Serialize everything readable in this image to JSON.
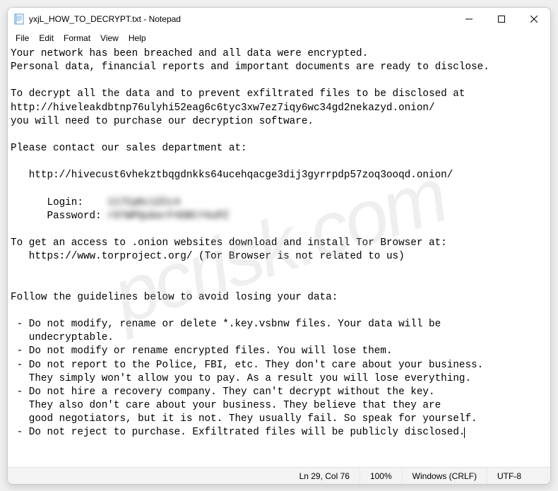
{
  "titlebar": {
    "title": "yxjL_HOW_TO_DECRYPT.txt - Notepad"
  },
  "menubar": {
    "file": "File",
    "edit": "Edit",
    "format": "Format",
    "view": "View",
    "help": "Help"
  },
  "content": {
    "line1": "Your network has been breached and all data were encrypted.",
    "line2": "Personal data, financial reports and important documents are ready to disclose.",
    "line3": "",
    "line4": "To decrypt all the data and to prevent exfiltrated files to be disclosed at",
    "line5": "http://hiveleakdbtnp76ulyhi52eag6c6tyc3xw7ez7iqy6wc34gd2nekazyd.onion/",
    "line6": "you will need to purchase our decryption software.",
    "line7": "",
    "line8": "Please contact our sales department at:",
    "line9": "",
    "line10": "   http://hivecust6vhekztbqgdnkks64ucehqacge3dij3gyrrpdp57zoq3ooqd.onion/",
    "line11": "",
    "login_label": "      Login:    ",
    "login_value": "117CpKc1ZCc4",
    "password_label": "      Password: ",
    "password_value": "r97WPQuberF4GBtY4uPZ",
    "line14": "",
    "line15": "To get an access to .onion websites download and install Tor Browser at:",
    "line16": "   https://www.torproject.org/ (Tor Browser is not related to us)",
    "line17": "",
    "line18": "",
    "line19": "Follow the guidelines below to avoid losing your data:",
    "line20": "",
    "line21": " - Do not modify, rename or delete *.key.vsbnw files. Your data will be",
    "line22": "   undecryptable.",
    "line23": " - Do not modify or rename encrypted files. You will lose them.",
    "line24": " - Do not report to the Police, FBI, etc. They don't care about your business.",
    "line25": "   They simply won't allow you to pay. As a result you will lose everything.",
    "line26": " - Do not hire a recovery company. They can't decrypt without the key.",
    "line27": "   They also don't care about your business. They believe that they are",
    "line28": "   good negotiators, but it is not. They usually fail. So speak for yourself.",
    "line29": " - Do not reject to purchase. Exfiltrated files will be publicly disclosed."
  },
  "statusbar": {
    "position": "Ln 29, Col 76",
    "zoom": "100%",
    "lineending": "Windows (CRLF)",
    "encoding": "UTF-8"
  },
  "watermark": "pcrisk.com"
}
